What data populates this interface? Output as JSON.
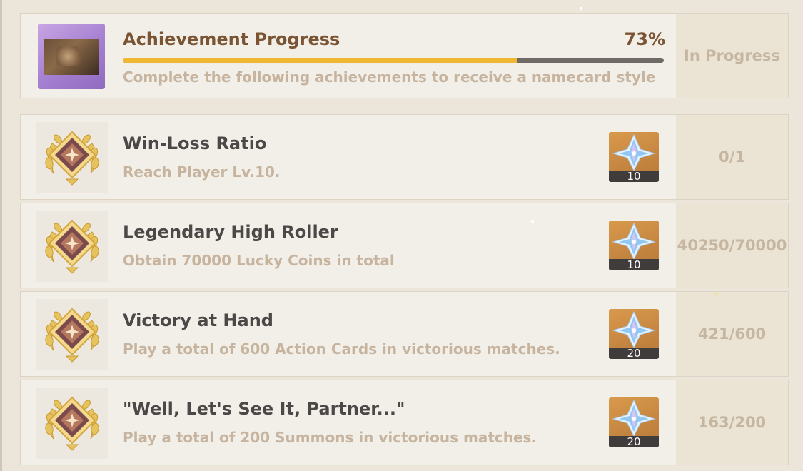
{
  "summary": {
    "title": "Achievement Progress",
    "percent_label": "73%",
    "progress_fraction": 0.73,
    "description": "Complete the following achievements to receive a namecard style",
    "status": "In Progress"
  },
  "achievements": [
    {
      "name": "Win-Loss Ratio",
      "requirement": "Reach Player Lv.10.",
      "reward_qty": "10",
      "progress": "0/1"
    },
    {
      "name": "Legendary High Roller",
      "requirement": "Obtain 70000 Lucky Coins in total",
      "reward_qty": "10",
      "progress": "40250/70000"
    },
    {
      "name": "Victory at Hand",
      "requirement": "Play a total of 600 Action Cards in victorious matches.",
      "reward_qty": "20",
      "progress": "421/600"
    },
    {
      "name": "\"Well, Let's See It, Partner...\"",
      "requirement": "Play a total of 200 Summons in victorious matches.",
      "reward_qty": "20",
      "progress": "163/200"
    }
  ],
  "icons": {
    "badge": "achievement-laurel-badge-icon",
    "reward": "primogem-icon"
  },
  "colors": {
    "progress_fill": "#f0b732",
    "progress_track": "#706a66",
    "title": "#7a5433",
    "muted": "#c7b49f"
  }
}
